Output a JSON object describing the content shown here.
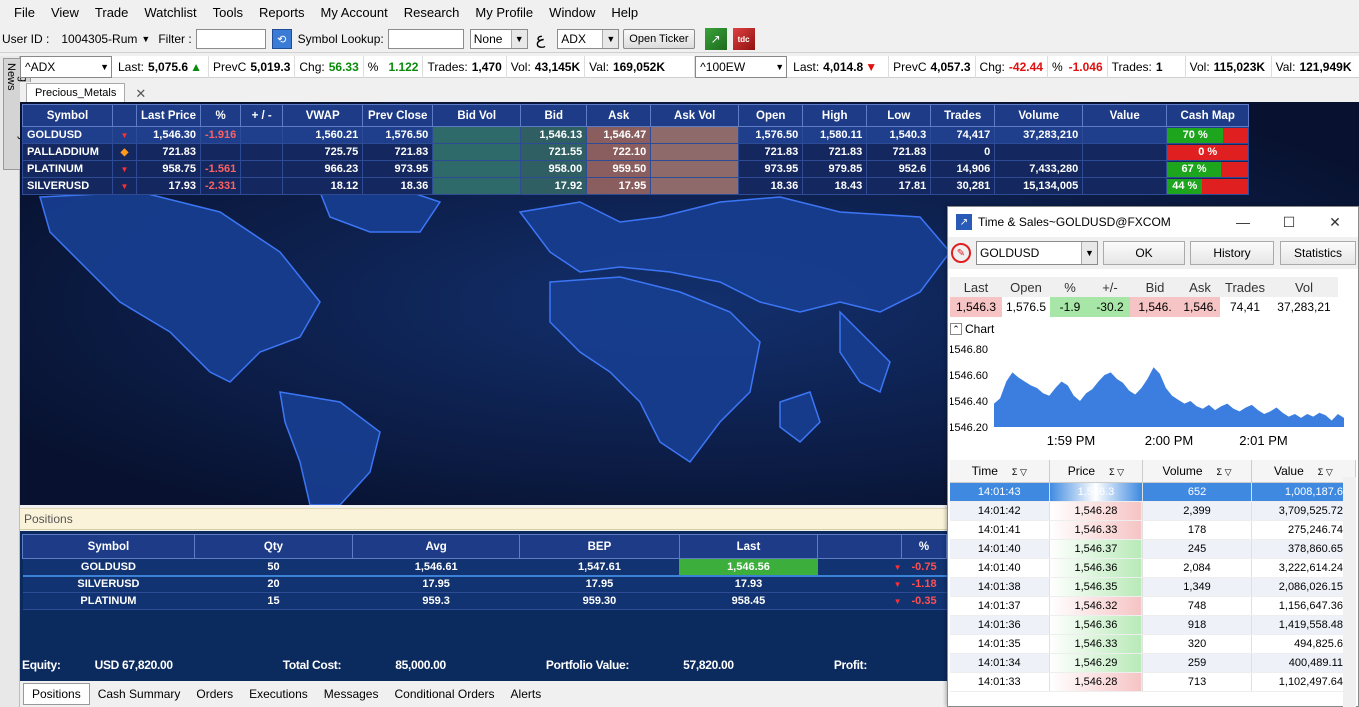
{
  "menu": [
    "File",
    "View",
    "Trade",
    "Watchlist",
    "Tools",
    "Reports",
    "My Account",
    "Research",
    "My Profile",
    "Window",
    "Help"
  ],
  "toolbar": {
    "user_label": "User ID :",
    "user_value": "1004305-Rum",
    "filter_label": "Filter :",
    "symbol_lookup_label": "Symbol Lookup:",
    "none_select": "None",
    "arabic_glyph": "ع",
    "exchange_select": "ADX",
    "open_ticker": "Open Ticker"
  },
  "ticker": {
    "left": {
      "symbol": "^ADX",
      "last_label": "Last:",
      "last": "5,075.6",
      "prevc_label": "PrevC",
      "prevc": "5,019.3",
      "chg_label": "Chg:",
      "chg": "56.33",
      "pct_label": "%",
      "pct": "1.122",
      "trades_label": "Trades:",
      "trades": "1,470",
      "vol_label": "Vol:",
      "vol": "43,145K",
      "val_label": "Val:",
      "val": "169,052K"
    },
    "right": {
      "symbol": "^100EW",
      "last_label": "Last:",
      "last": "4,014.8",
      "prevc_label": "PrevC",
      "prevc": "4,057.3",
      "chg_label": "Chg:",
      "chg": "-42.44",
      "pct_label": "%",
      "pct": "-1.046",
      "trades_label": "Trades:",
      "trades": "1",
      "vol_label": "Vol:",
      "vol": "115,023K",
      "val_label": "Val:",
      "val": "121,949K"
    }
  },
  "sidetab": "ZagTrader Daily News",
  "tab": {
    "label": "Precious_Metals",
    "close": "✕"
  },
  "watchlist": {
    "headers": [
      "Symbol",
      "",
      "Last Price",
      "%",
      "+ / -",
      "VWAP",
      "Prev Close",
      "Bid Vol",
      "Bid",
      "Ask",
      "Ask Vol",
      "Open",
      "High",
      "Low",
      "Trades",
      "Volume",
      "Value",
      "Cash Map"
    ],
    "rows": [
      {
        "symbol": "GOLDUSD",
        "dir": "down",
        "last": "1,546.30",
        "pct": "-1.916",
        "chg": "",
        "vwap": "1,560.21",
        "prev": "1,576.50",
        "bidvol": "",
        "bid": "1,546.13",
        "ask": "1,546.47",
        "askvol": "",
        "open": "1,576.50",
        "high": "1,580.11",
        "low": "1,540.3",
        "trades": "74,417",
        "volume": "37,283,210",
        "value": "",
        "cashmap": "70 %",
        "cashpct": 70
      },
      {
        "symbol": "PALLADDIUM",
        "dir": "flat",
        "last": "721.83",
        "pct": "",
        "chg": "",
        "vwap": "725.75",
        "prev": "721.83",
        "bidvol": "",
        "bid": "721.55",
        "ask": "722.10",
        "askvol": "",
        "open": "721.83",
        "high": "721.83",
        "low": "721.83",
        "trades": "0",
        "volume": "",
        "value": "",
        "cashmap": "0 %",
        "cashpct": 0
      },
      {
        "symbol": "PLATINUM",
        "dir": "down",
        "last": "958.75",
        "pct": "-1.561",
        "chg": "",
        "vwap": "966.23",
        "prev": "973.95",
        "bidvol": "",
        "bid": "958.00",
        "ask": "959.50",
        "askvol": "",
        "open": "973.95",
        "high": "979.85",
        "low": "952.6",
        "trades": "14,906",
        "volume": "7,433,280",
        "value": "",
        "cashmap": "67 %",
        "cashpct": 67
      },
      {
        "symbol": "SILVERUSD",
        "dir": "down",
        "last": "17.93",
        "pct": "-2.331",
        "chg": "",
        "vwap": "18.12",
        "prev": "18.36",
        "bidvol": "",
        "bid": "17.92",
        "ask": "17.95",
        "askvol": "",
        "open": "18.36",
        "high": "18.43",
        "low": "17.81",
        "trades": "30,281",
        "volume": "15,134,005",
        "value": "",
        "cashmap": "44 %",
        "cashpct": 44
      }
    ]
  },
  "positions": {
    "title": "Positions",
    "headers": [
      "Symbol",
      "Qty",
      "Avg",
      "BEP",
      "Last",
      "",
      "%"
    ],
    "rows": [
      {
        "symbol": "GOLDUSD",
        "qty": "50",
        "avg": "1,546.61",
        "bep": "1,547.61",
        "last": "1,546.56",
        "pct": "-0.75"
      },
      {
        "symbol": "SILVERUSD",
        "qty": "20",
        "avg": "17.95",
        "bep": "17.95",
        "last": "17.93",
        "pct": "-1.18"
      },
      {
        "symbol": "PLATINUM",
        "qty": "15",
        "avg": "959.3",
        "bep": "959.30",
        "last": "958.45",
        "pct": "-0.35"
      }
    ],
    "summary": {
      "equity_label": "Equity:",
      "equity": "USD 67,820.00",
      "cost_label": "Total Cost:",
      "cost": "85,000.00",
      "pv_label": "Portfolio Value:",
      "pv": "57,820.00",
      "profit_label": "Profit:"
    }
  },
  "bottom_tabs": [
    "Positions",
    "Cash Summary",
    "Orders",
    "Executions",
    "Messages",
    "Conditional Orders",
    "Alerts"
  ],
  "timesales": {
    "title": "Time & Sales~GOLDUSD@FXCOM",
    "symbol": "GOLDUSD",
    "ok": "OK",
    "history": "History",
    "statistics": "Statistics",
    "quote_headers": [
      "Last",
      "Open",
      "%",
      "+/-",
      "Bid",
      "Ask",
      "Trades",
      "Vol"
    ],
    "quote_values": [
      "1,546.3",
      "1,576.5",
      "-1.9",
      "-30.2",
      "1,546.",
      "1,546.",
      "74,41",
      "37,283,21"
    ],
    "chart_label": "Chart",
    "columns": [
      "Time",
      "Price",
      "Volume",
      "Value"
    ],
    "rows": [
      {
        "time": "14:01:43",
        "price": "1,546.3",
        "volume": "652",
        "value": "1,008,187.6",
        "dir": "first"
      },
      {
        "time": "14:01:42",
        "price": "1,546.28",
        "volume": "2,399",
        "value": "3,709,525.72",
        "dir": "down"
      },
      {
        "time": "14:01:41",
        "price": "1,546.33",
        "volume": "178",
        "value": "275,246.74",
        "dir": "down"
      },
      {
        "time": "14:01:40",
        "price": "1,546.37",
        "volume": "245",
        "value": "378,860.65",
        "dir": "up"
      },
      {
        "time": "14:01:40",
        "price": "1,546.36",
        "volume": "2,084",
        "value": "3,222,614.24",
        "dir": "up"
      },
      {
        "time": "14:01:38",
        "price": "1,546.35",
        "volume": "1,349",
        "value": "2,086,026.15",
        "dir": "up"
      },
      {
        "time": "14:01:37",
        "price": "1,546.32",
        "volume": "748",
        "value": "1,156,647.36",
        "dir": "down"
      },
      {
        "time": "14:01:36",
        "price": "1,546.36",
        "volume": "918",
        "value": "1,419,558.48",
        "dir": "up"
      },
      {
        "time": "14:01:35",
        "price": "1,546.33",
        "volume": "320",
        "value": "494,825.6",
        "dir": "up"
      },
      {
        "time": "14:01:34",
        "price": "1,546.29",
        "volume": "259",
        "value": "400,489.11",
        "dir": "up"
      },
      {
        "time": "14:01:33",
        "price": "1,546.28",
        "volume": "713",
        "value": "1,102,497.64",
        "dir": "down"
      }
    ]
  },
  "chart_data": {
    "type": "area",
    "title": "",
    "xlabel": "",
    "ylabel": "",
    "yticks": [
      "1546.80",
      "1546.60",
      "1546.40",
      "1546.20"
    ],
    "xticks": [
      "1:59 PM",
      "2:00 PM",
      "2:01 PM"
    ],
    "ylim": [
      1546.2,
      1546.8
    ],
    "values": [
      1546.38,
      1546.42,
      1546.55,
      1546.62,
      1546.58,
      1546.55,
      1546.52,
      1546.5,
      1546.46,
      1546.44,
      1546.5,
      1546.55,
      1546.52,
      1546.44,
      1546.4,
      1546.46,
      1546.49,
      1546.55,
      1546.6,
      1546.62,
      1546.57,
      1546.54,
      1546.48,
      1546.45,
      1546.5,
      1546.57,
      1546.66,
      1546.61,
      1546.5,
      1546.44,
      1546.41,
      1546.38,
      1546.4,
      1546.36,
      1546.34,
      1546.37,
      1546.33,
      1546.36,
      1546.38,
      1546.34,
      1546.32,
      1546.35,
      1546.37,
      1546.33,
      1546.3,
      1546.32,
      1546.35,
      1546.31,
      1546.28,
      1546.3,
      1546.27,
      1546.3,
      1546.28,
      1546.31,
      1546.29,
      1546.25,
      1546.3,
      1546.27
    ]
  },
  "colors": {
    "up_green": "#0a8a0a",
    "down_red": "#e01010",
    "panel_bg": "#0b1638",
    "header_blue": "#1d3b86",
    "chart_fill": "#3b7ee0"
  }
}
